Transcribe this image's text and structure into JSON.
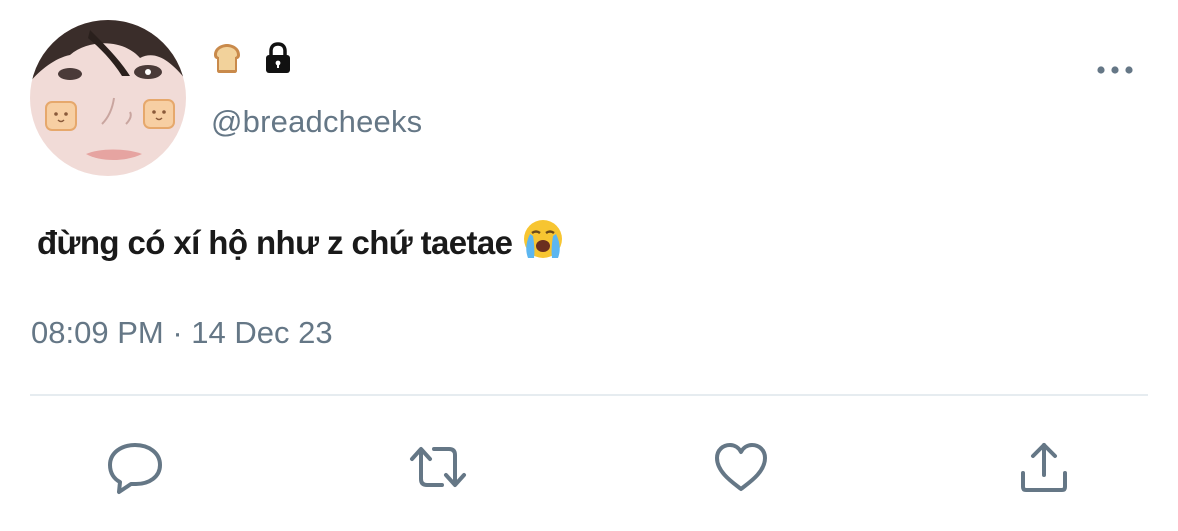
{
  "tweet": {
    "author_handle": "@breadcheeks",
    "name_icons": [
      "bread-icon",
      "lock-icon"
    ],
    "text": "đừng có xí hộ như z chứ taetae",
    "text_emoji": "crying-face-icon",
    "time": "08:09 PM",
    "separator": " · ",
    "date": "14 Dec 23"
  },
  "actions": [
    "reply-icon",
    "retweet-icon",
    "like-icon",
    "share-icon"
  ],
  "colors": {
    "secondary_text": "#657786",
    "icon": "#657786",
    "divider": "#e6ecf0",
    "primary_text": "#1a1a1a"
  }
}
